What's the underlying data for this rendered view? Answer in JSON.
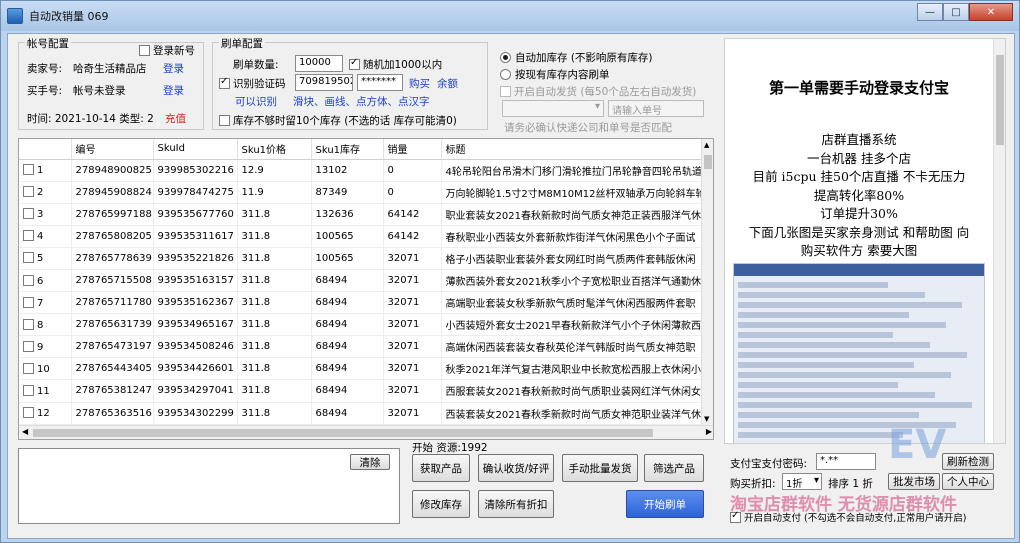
{
  "window": {
    "title": "自动改销量 069"
  },
  "account": {
    "group_label": "帐号配置",
    "login_new_label": "登录新号",
    "seller_label": "卖家号:",
    "seller_value": "哈奇生活精品店",
    "switch_link": "登录",
    "buyer_label": "买手号:",
    "buyer_value": "帐号未登录",
    "login_link": "登录",
    "time_label": "时间: 2021-10-14 类型: 2",
    "recharge_link": "充值"
  },
  "brush": {
    "group_label": "刷单配置",
    "quantity_label": "刷单数量:",
    "quantity_value": "10000",
    "random_label": "随机加1000以内",
    "captcha_label": "识别验证码",
    "captcha_value": "709819502",
    "captcha_pass": "*******",
    "buy_link": "购买",
    "balance_link": "余额",
    "can_recognize": "可以识别",
    "captcha_types": "滑块、画线、点方体、点汉字",
    "stock_label": "库存不够时留10个库存 (不选的话 库存可能清0)"
  },
  "options": {
    "auto_stock": "自动加库存 (不影响原有库存)",
    "by_stock": "按现有库存内容刷单",
    "auto_ship": "开启自动发货 (每50个品左右自动发货)",
    "order_placeholder": "请输入单号",
    "express_note": "请务必确认快递公司和单号是否匹配"
  },
  "table": {
    "headers": [
      "编号",
      "SkuId",
      "Sku1价格",
      "Sku1库存",
      "销量",
      "标题"
    ],
    "rows": [
      [
        "1",
        "278948900825",
        "939985302216",
        "12.9",
        "13102",
        "0",
        "4轮吊轮阳台吊滑木门移门滑轮推拉门吊轮静音四轮吊轨道"
      ],
      [
        "2",
        "278945908824",
        "939978474275",
        "11.9",
        "87349",
        "0",
        "万向轮脚轮1.5寸2寸M8M10M12丝杆双轴承万向轮斜车轮"
      ],
      [
        "3",
        "278765997188",
        "939535677760",
        "311.8",
        "132636",
        "64142",
        "职业套装女2021春秋新款时尚气质女神范正装西服洋气休闲"
      ],
      [
        "4",
        "278765808205",
        "939535311617",
        "311.8",
        "100565",
        "64142",
        "春秋职业小西装女外套新款炸街洋气休闲黑色小个子面试"
      ],
      [
        "5",
        "278765778639",
        "939535221826",
        "311.8",
        "100565",
        "32071",
        "格子小西装职业套装外套女网红时尚气质两件套韩版休闲"
      ],
      [
        "6",
        "278765715508",
        "939535163157",
        "311.8",
        "68494",
        "32071",
        "薄款西装外套女2021秋季小个子宽松职业百搭洋气通勤休闲"
      ],
      [
        "7",
        "278765711780",
        "939535162367",
        "311.8",
        "68494",
        "32071",
        "高端职业套装女秋季新款气质时髦洋气休闲西服两件套职"
      ],
      [
        "8",
        "278765631739",
        "939534965167",
        "311.8",
        "68494",
        "32071",
        "小西装短外套女士2021早春秋新款洋气小个子休闲薄款西"
      ],
      [
        "9",
        "278765473197",
        "939534508246",
        "311.8",
        "68494",
        "32071",
        "高端休闲西装套装女春秋英伦洋气韩版时尚气质女神范职"
      ],
      [
        "10",
        "278765443405",
        "939534426601",
        "311.8",
        "68494",
        "32071",
        "秋季2021年洋气复古港风职业中长款宽松西服上衣休闲小"
      ],
      [
        "11",
        "278765381247",
        "939534297041",
        "311.8",
        "68494",
        "32071",
        "西服套装女2021春秋新款时尚气质职业装网红洋气休闲女"
      ],
      [
        "12",
        "278765363516",
        "939534302299",
        "311.8",
        "68494",
        "32071",
        "西装套装女2021春秋季新款时尚气质女神范职业装洋气休"
      ]
    ]
  },
  "bottom": {
    "clear_label": "清除",
    "start_resource": "开始 资源:1992",
    "get_product": "获取产品",
    "confirm_receipt": "确认收货/好评",
    "manual_ship": "手动批量发货",
    "filter_product": "筛选产品",
    "modify_stock": "修改库存",
    "clear_discount": "清除所有折扣",
    "start_brush": "开始刷单"
  },
  "promo": {
    "heading": "第一单需要手动登录支付宝",
    "lines": [
      "店群直播系统",
      "一台机器 挂多个店",
      "目前 i5cpu 挂50个店直播 不卡无压力",
      "提高转化率80%",
      "订单提升30%",
      "下面几张图是买家亲身测试 和帮助图 向",
      "购买软件方 索要大图"
    ]
  },
  "pay": {
    "password_label": "支付宝支付密码:",
    "password_value": "*.**",
    "refresh_label": "刷新检测",
    "discount_label": "购买折扣:",
    "discount_value": "1折",
    "sort_label": "排序 1 折",
    "market_label": "批发市场",
    "personal_center": "个人中心",
    "auto_pay_label": "开启自动支付 (不勾选不会自动支付,正常用户请开启)"
  },
  "watermark": {
    "text1": "EV",
    "text2": "淘宝店群软件 无货源店群软件"
  }
}
